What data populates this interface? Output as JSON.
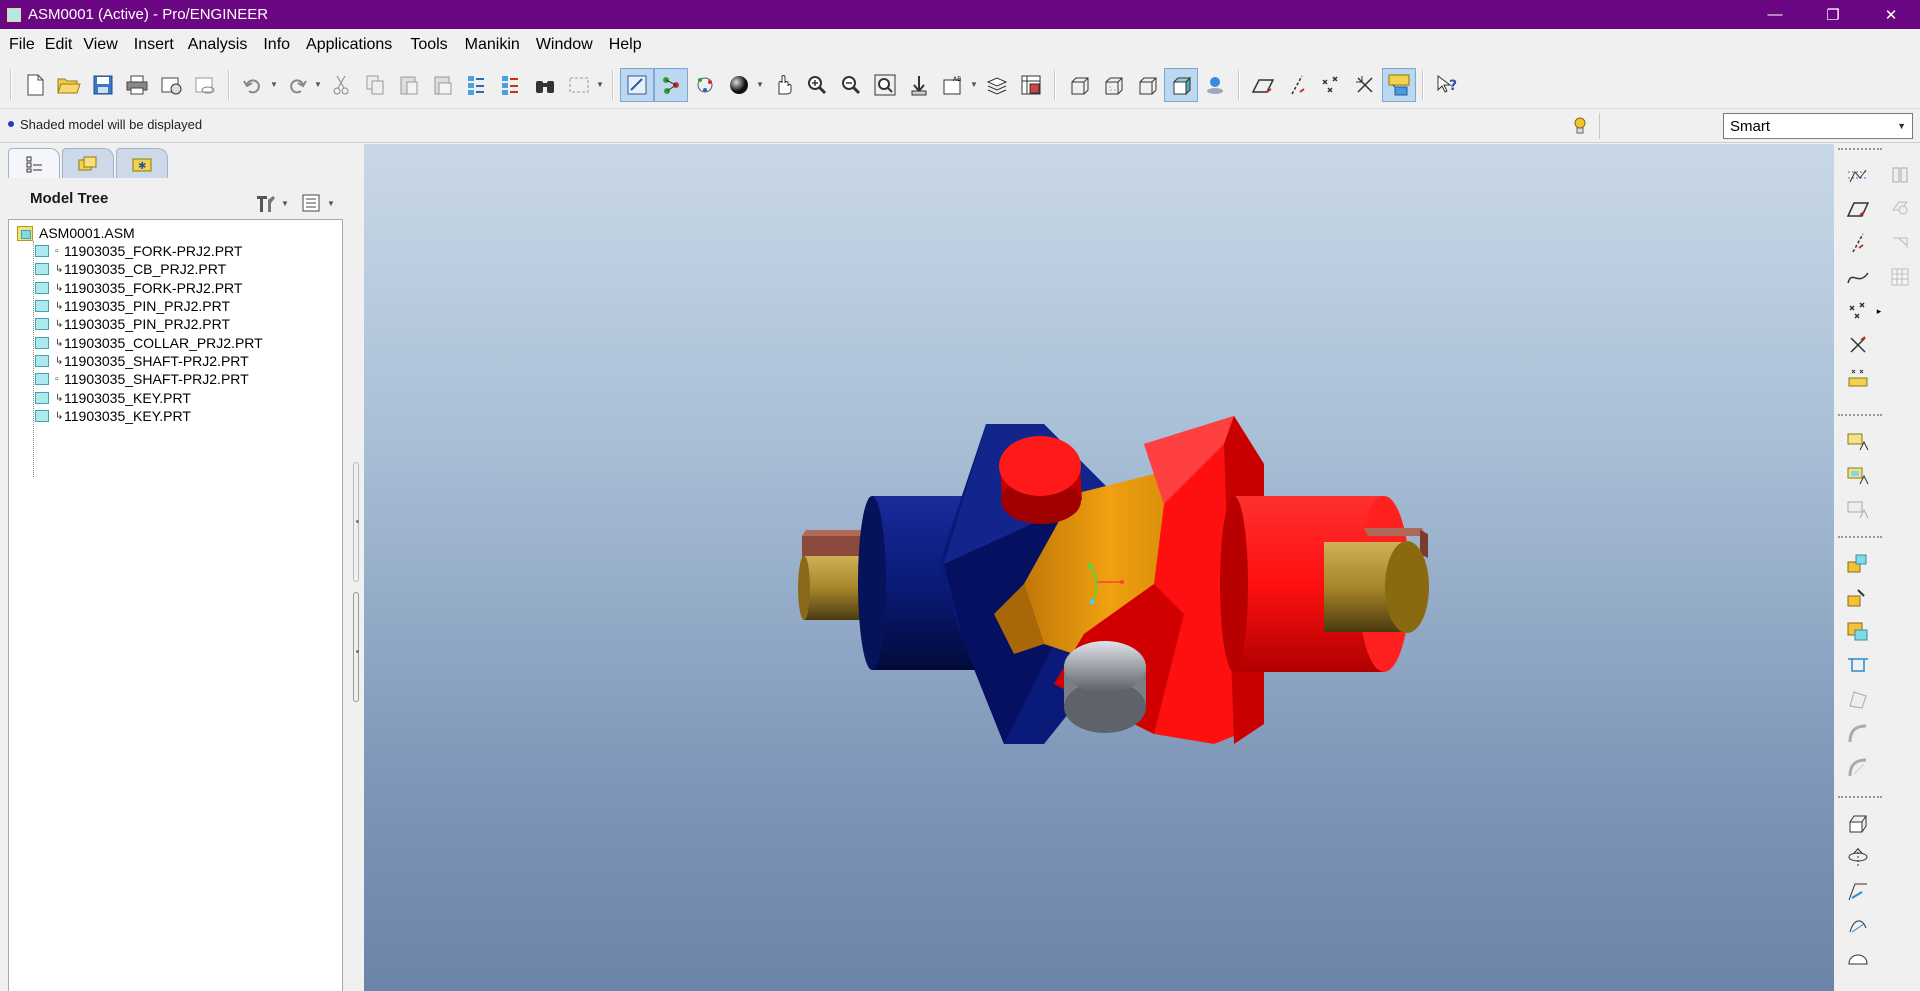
{
  "window": {
    "title": "ASM0001 (Active) - Pro/ENGINEER",
    "minimize_glyph": "—",
    "restore_glyph": "❐",
    "close_glyph": "✕"
  },
  "menu": [
    "File",
    "Edit",
    "View",
    "Insert",
    "Analysis",
    "Info",
    "Applications",
    "Tools",
    "Manikin",
    "Window",
    "Help"
  ],
  "status": {
    "message": "Shaded model will be displayed"
  },
  "filter": {
    "selected": "Smart"
  },
  "model_tree": {
    "title": "Model Tree",
    "root": "ASM0001.ASM",
    "items": [
      "11903035_FORK-PRJ2.PRT",
      "11903035_CB_PRJ2.PRT",
      "11903035_FORK-PRJ2.PRT",
      "11903035_PIN_PRJ2.PRT",
      "11903035_PIN_PRJ2.PRT",
      "11903035_COLLAR_PRJ2.PRT",
      "11903035_SHAFT-PRJ2.PRT",
      "11903035_SHAFT-PRJ2.PRT",
      "11903035_KEY.PRT",
      "11903035_KEY.PRT"
    ]
  },
  "colors": {
    "titlebar": "#6b0782",
    "fork_blue": "#0a1a78",
    "fork_red": "#ff1010",
    "shaft_gold": "#a8862a",
    "collar_orange": "#f0a010",
    "pin_gray": "#b8bcc4",
    "key_brown": "#8b4a3c"
  }
}
